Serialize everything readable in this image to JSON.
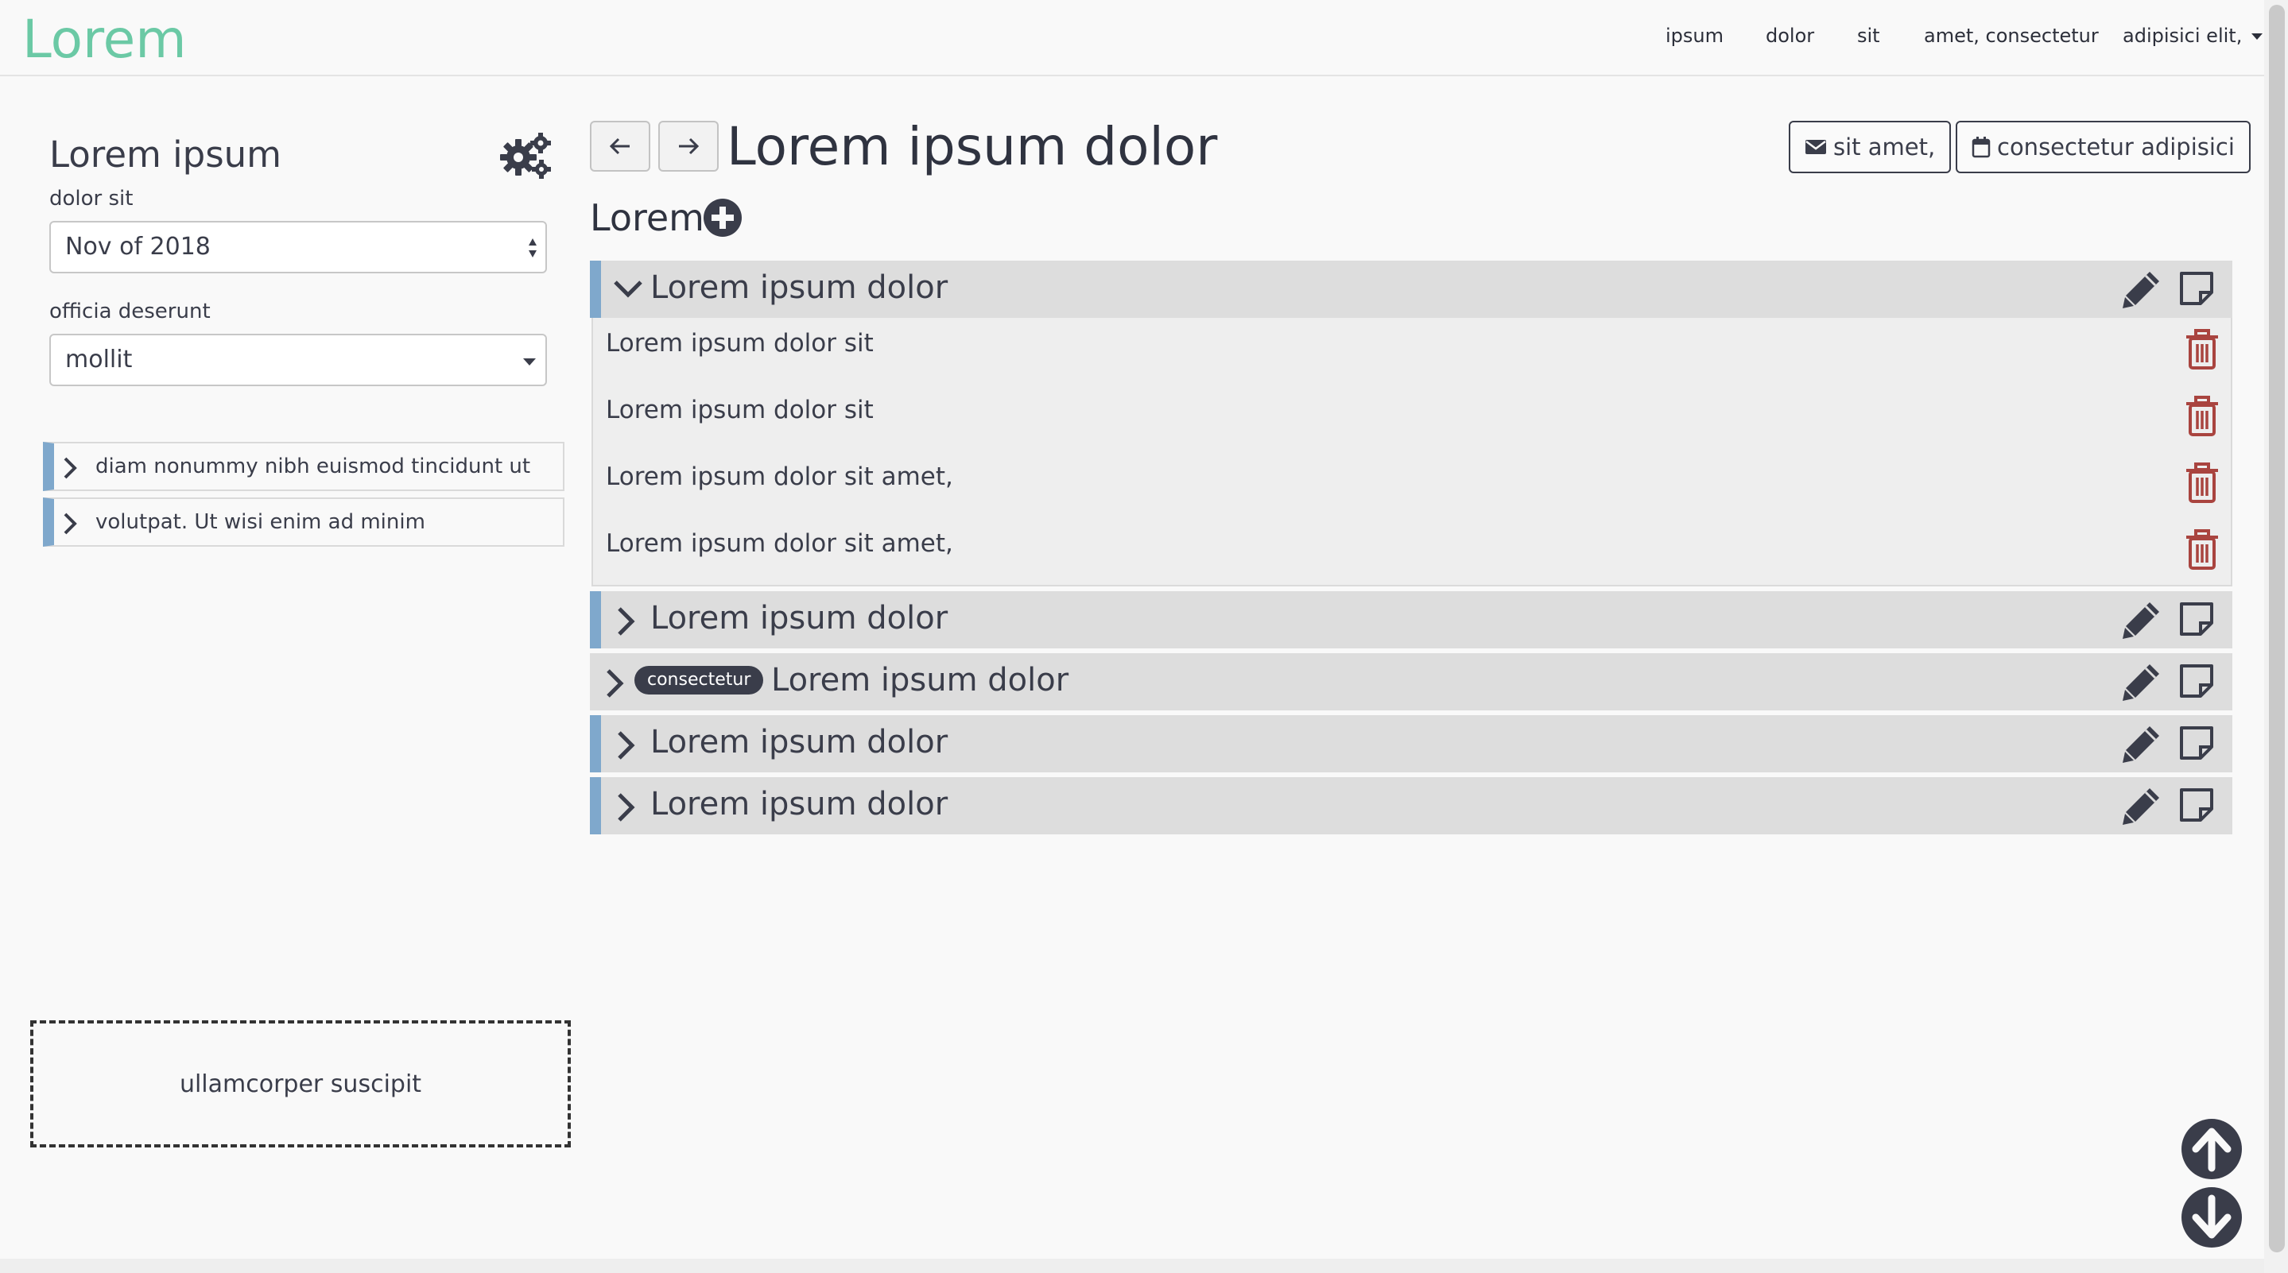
{
  "navbar": {
    "brand": "Lorem",
    "links": [
      "ipsum",
      "dolor",
      "sit",
      "amet, consectetur"
    ],
    "dropdown_label": "adipisici elit,"
  },
  "sidebar": {
    "title": "Lorem ipsum",
    "settings_icon": "gears-icon",
    "date_label": "dolor sit",
    "date_value": "Nov of 2018",
    "filter_label": "officia deserunt",
    "filter_value": "mollit",
    "items": [
      {
        "label": "diam nonummy nibh euismod tincidunt ut"
      },
      {
        "label": "volutpat. Ut wisi enim ad minim"
      }
    ],
    "dropzone_label": "ullamcorper suscipit"
  },
  "main": {
    "title": "Lorem ipsum dolor",
    "buttons": {
      "email_label": "sit amet,",
      "calendar_label": "consectetur adipisici"
    },
    "section_title": "Lorem",
    "groups": [
      {
        "label": "Lorem ipsum dolor",
        "expanded": true,
        "badge": ""
      },
      {
        "label": "Lorem ipsum dolor",
        "expanded": false,
        "badge": ""
      },
      {
        "label": "Lorem ipsum dolor",
        "expanded": false,
        "badge": "consectetur"
      },
      {
        "label": "Lorem ipsum dolor",
        "expanded": false,
        "badge": ""
      },
      {
        "label": "Lorem ipsum dolor",
        "expanded": false,
        "badge": ""
      }
    ],
    "expanded_rows": [
      "Lorem ipsum dolor sit",
      "Lorem ipsum dolor sit",
      "Lorem ipsum dolor sit amet,",
      "Lorem ipsum dolor sit amet,"
    ]
  },
  "colors": {
    "brand": "#6bc9a5",
    "accent_bar": "#7fa8cc",
    "trash": "#a9443f",
    "text": "#3a3d4a"
  }
}
